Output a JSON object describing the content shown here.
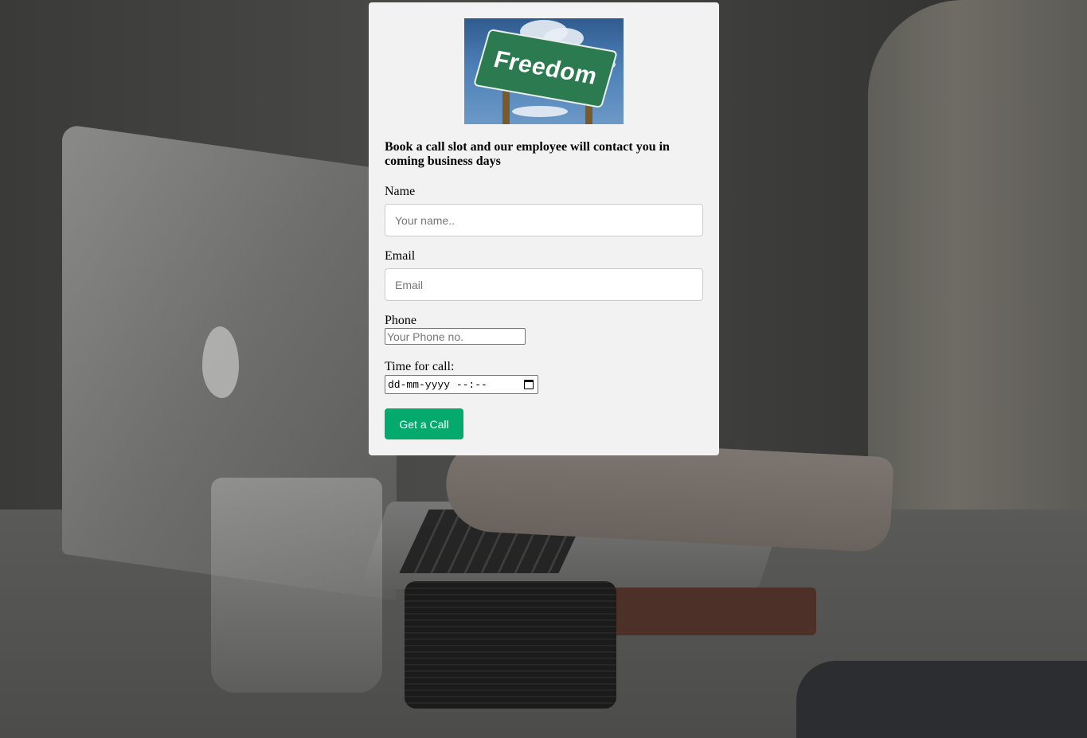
{
  "hero": {
    "sign_text": "Freedom"
  },
  "form": {
    "intro": "Book a call slot and our employee will contact you in coming business days",
    "name_label": "Name",
    "name_placeholder": "Your name..",
    "email_label": "Email",
    "email_placeholder": "Email",
    "phone_label": "Phone",
    "phone_placeholder": "Your Phone no.",
    "time_label": "Time for call:",
    "time_placeholder": "dd-mm-yyyy --:--",
    "submit_label": "Get a Call"
  },
  "colors": {
    "card_bg": "#f2f2f2",
    "button_bg": "#04aa6d",
    "sign_green": "#2b7a50"
  },
  "icons": {
    "calendar": "calendar-icon"
  }
}
